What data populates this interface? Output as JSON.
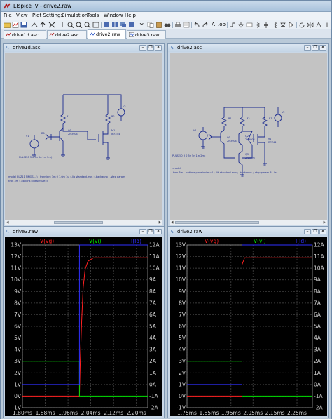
{
  "window": {
    "title": "LTspice IV - drive2.raw"
  },
  "menu": [
    "File",
    "View",
    "Plot Settings",
    "Simulation",
    "Tools",
    "Window",
    "Help"
  ],
  "tabs": [
    {
      "label": "drive1d.asc",
      "icon": "schematic-icon",
      "active": false
    },
    {
      "label": "drive2.asc",
      "icon": "schematic-icon",
      "active": false
    },
    {
      "label": "drive2.raw",
      "icon": "waveform-icon",
      "active": true
    },
    {
      "label": "drive3.raw",
      "icon": "waveform-icon",
      "active": false
    }
  ],
  "schematic_windows": [
    {
      "title": "drive1d.asc"
    },
    {
      "title": "drive2.asc"
    }
  ],
  "plot_windows": [
    {
      "title": "drive3.raw"
    },
    {
      "title": "drive2.raw"
    }
  ],
  "colors": {
    "vg": "#ff2020",
    "vi": "#00e000",
    "id": "#3030ff",
    "grid": "#4d4d4d",
    "axis_text": "#d0d0d0"
  },
  "chart_data": [
    {
      "type": "line",
      "legend": [
        "V(vg)",
        "V(vi)",
        "I(Id)"
      ],
      "xlabel_ticks": [
        "1.80ms",
        "1.88ms",
        "1.96ms",
        "2.04ms",
        "2.12ms",
        "2.20ms"
      ],
      "xlim": [
        1.8,
        2.24
      ],
      "ylim_left": [
        -1,
        13
      ],
      "ylim_right": [
        -2,
        12
      ],
      "yticks_left": [
        "13V",
        "12V",
        "11V",
        "10V",
        "9V",
        "8V",
        "7V",
        "6V",
        "5V",
        "4V",
        "3V",
        "2V",
        "1V",
        "0V",
        "-1V"
      ],
      "yticks_right": [
        "12A",
        "11A",
        "10A",
        "9A",
        "8A",
        "7A",
        "6A",
        "5A",
        "4A",
        "3A",
        "2A",
        "1A",
        "0A",
        "-1A",
        "-2A"
      ],
      "series": [
        {
          "name": "V(vg)",
          "axis": "left",
          "x": [
            1.8,
            2.0,
            2.003,
            2.008,
            2.013,
            2.02,
            2.03,
            2.05,
            2.24
          ],
          "y": [
            0,
            0,
            3.0,
            6.5,
            9.3,
            10.9,
            11.6,
            11.9,
            11.9
          ]
        },
        {
          "name": "V(vi)",
          "axis": "left",
          "x": [
            1.8,
            2.0,
            2.0,
            2.24
          ],
          "y": [
            3.0,
            3.0,
            0,
            0
          ]
        },
        {
          "name": "I(Id)",
          "axis": "right",
          "x": [
            1.8,
            2.0,
            2.0,
            2.24
          ],
          "y": [
            0,
            0,
            12,
            12
          ]
        }
      ]
    },
    {
      "type": "line",
      "legend": [
        "V(vg)",
        "V(vi)",
        "I(Id)"
      ],
      "xlabel_ticks": [
        "1.75ms",
        "1.85ms",
        "1.95ms",
        "2.05ms",
        "2.15ms",
        "2.25ms"
      ],
      "xlim": [
        1.75,
        2.32
      ],
      "ylim_left": [
        -1,
        13
      ],
      "ylim_right": [
        -2,
        12
      ],
      "yticks_left": [
        "13V",
        "12V",
        "11V",
        "10V",
        "9V",
        "8V",
        "7V",
        "6V",
        "5V",
        "4V",
        "3V",
        "2V",
        "1V",
        "0V",
        "-1V"
      ],
      "yticks_right": [
        "12A",
        "11A",
        "10A",
        "9A",
        "8A",
        "7A",
        "6A",
        "5A",
        "4A",
        "3A",
        "2A",
        "1A",
        "0A",
        "-1A",
        "-2A"
      ],
      "series": [
        {
          "name": "V(vg)",
          "axis": "left",
          "x": [
            1.75,
            2.0,
            2.0,
            2.012,
            2.32
          ],
          "y": [
            0,
            0,
            11.3,
            11.9,
            11.9
          ]
        },
        {
          "name": "V(vi)",
          "axis": "left",
          "x": [
            1.75,
            2.0,
            2.0,
            2.32
          ],
          "y": [
            3.0,
            3.0,
            0,
            0
          ]
        },
        {
          "name": "I(Id)",
          "axis": "right",
          "x": [
            1.75,
            2.0,
            2.0,
            2.32
          ],
          "y": [
            0,
            0,
            12,
            12
          ]
        }
      ]
    }
  ]
}
